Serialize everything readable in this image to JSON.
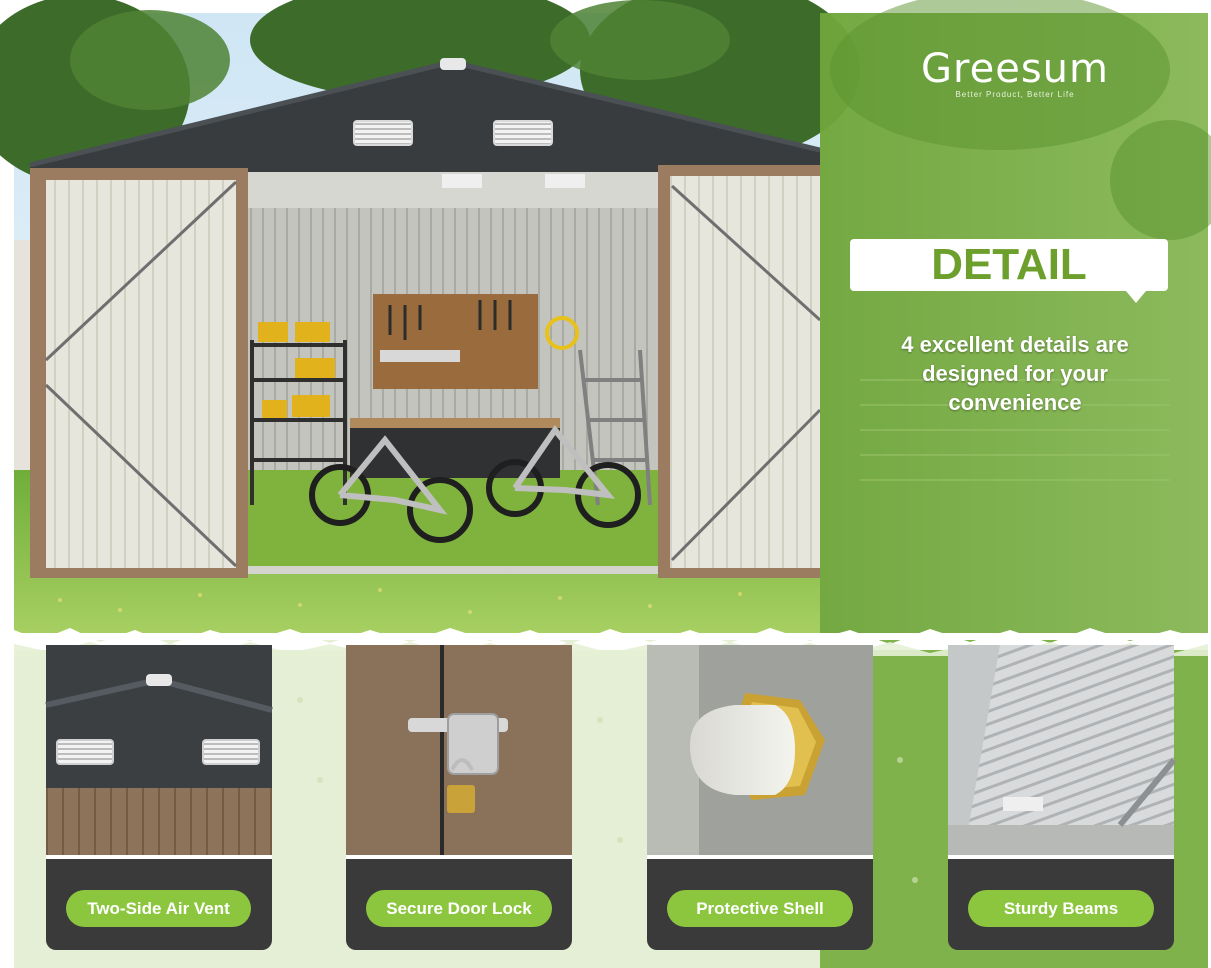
{
  "brand": {
    "name": "Greesum",
    "tagline": "Better Product, Better Life"
  },
  "panel": {
    "heading": "DETAIL",
    "subtitle_lines": [
      "4 excellent details are",
      "designed for your",
      "convenience"
    ]
  },
  "features": [
    {
      "label": "Two-Side Air Vent",
      "icon": "air-vent-icon"
    },
    {
      "label": "Secure Door Lock",
      "icon": "padlock-icon"
    },
    {
      "label": "Protective Shell",
      "icon": "bolt-cap-icon"
    },
    {
      "label": "Sturdy Beams",
      "icon": "roof-beam-icon"
    }
  ],
  "colors": {
    "accent_green": "#8cc63f",
    "panel_green": "#6c9f2b",
    "roof_dark": "#3b3f42",
    "door_cream": "#e7e6dc",
    "door_trim": "#9b7c61",
    "card_dark": "#3a3a3a"
  }
}
